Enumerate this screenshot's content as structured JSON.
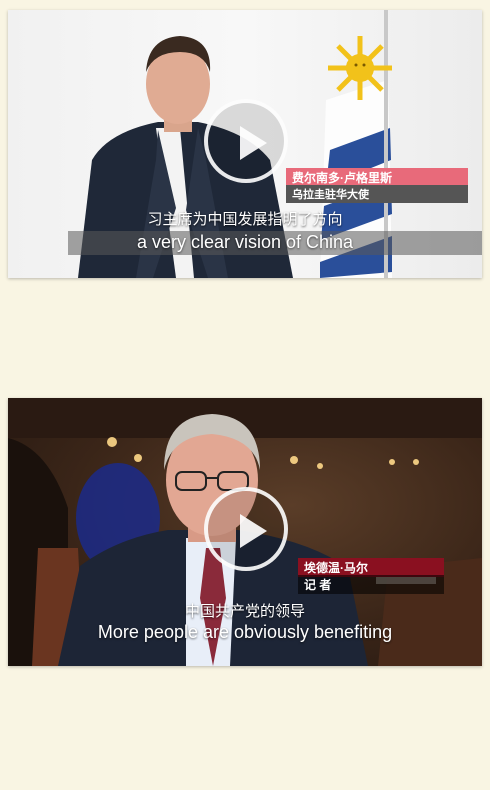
{
  "videos": [
    {
      "speaker_name": "费尔南多·卢格里斯",
      "speaker_title": "乌拉圭驻华大使",
      "subtitle_zh": "习主席为中国发展指明了方向",
      "subtitle_en": "a very clear vision of China",
      "name_color": "#e86a7a",
      "title_color": "#555555"
    },
    {
      "speaker_name": "埃德温·马尔",
      "speaker_title": "记 者",
      "subtitle_zh": "中国共产党的领导",
      "subtitle_en": "More people are obviously benefiting",
      "name_color": "#8a1020",
      "title_color": "#000000"
    }
  ],
  "icons": {
    "play": "play-icon"
  }
}
